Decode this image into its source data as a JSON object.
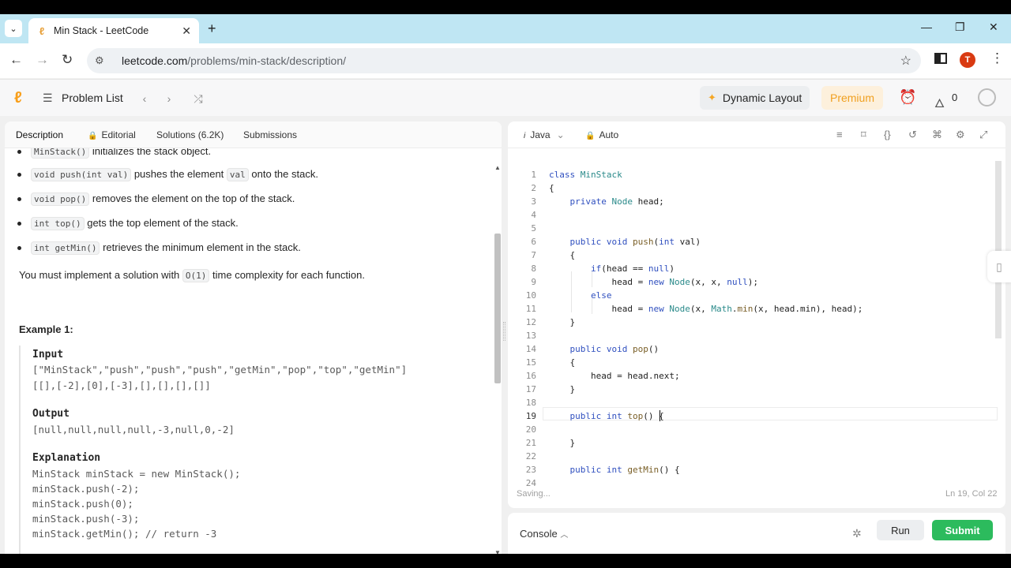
{
  "browser": {
    "tab_title": "Min Stack - LeetCode",
    "url_host": "leetcode.com",
    "url_path": "/problems/min-stack/description/",
    "profile_initial": "T"
  },
  "header": {
    "problem_list": "Problem List",
    "dynamic_layout": "Dynamic Layout",
    "premium": "Premium",
    "streak_count": "0"
  },
  "left_tabs": {
    "description": "Description",
    "editorial": "Editorial",
    "solutions": "Solutions (6.2K)",
    "submissions": "Submissions"
  },
  "description": {
    "bullets": [
      {
        "code": "MinStack()",
        "text": " initializes the stack object."
      },
      {
        "code": "void push(int val)",
        "text": " pushes the element ",
        "code2": "val",
        "text2": " onto the stack."
      },
      {
        "code": "void pop()",
        "text": " removes the element on the top of the stack."
      },
      {
        "code": "int top()",
        "text": " gets the top element of the stack."
      },
      {
        "code": "int getMin()",
        "text": " retrieves the minimum element in the stack."
      }
    ],
    "complexity_pre": "You must implement a solution with ",
    "complexity_code": "O(1)",
    "complexity_post": " time complexity for each function.",
    "example_title": "Example 1:",
    "input_label": "Input",
    "input_line1": "[\"MinStack\",\"push\",\"push\",\"push\",\"getMin\",\"pop\",\"top\",\"getMin\"]",
    "input_line2": "[[],[-2],[0],[-3],[],[],[],[]]",
    "output_label": "Output",
    "output_line": "[null,null,null,null,-3,null,0,-2]",
    "explanation_label": "Explanation",
    "explanation_lines": [
      "MinStack minStack = new MinStack();",
      "minStack.push(-2);",
      "minStack.push(0);",
      "minStack.push(-3);",
      "minStack.getMin(); // return -3"
    ]
  },
  "editor": {
    "language": "Java",
    "mode": "Auto",
    "status": "Saving...",
    "cursor_pos": "Ln 19, Col 22",
    "line_numbers": [
      "1",
      "2",
      "3",
      "4",
      "5",
      "6",
      "7",
      "8",
      "9",
      "10",
      "11",
      "12",
      "13",
      "14",
      "15",
      "16",
      "17",
      "18",
      "19",
      "20",
      "21",
      "22",
      "23",
      "24"
    ]
  },
  "console": {
    "label": "Console",
    "run": "Run",
    "submit": "Submit"
  },
  "colors": {
    "submit_green": "#2cbb5d",
    "premium_orange": "#f0a020",
    "tabbar_blue": "#bfe6f3"
  }
}
